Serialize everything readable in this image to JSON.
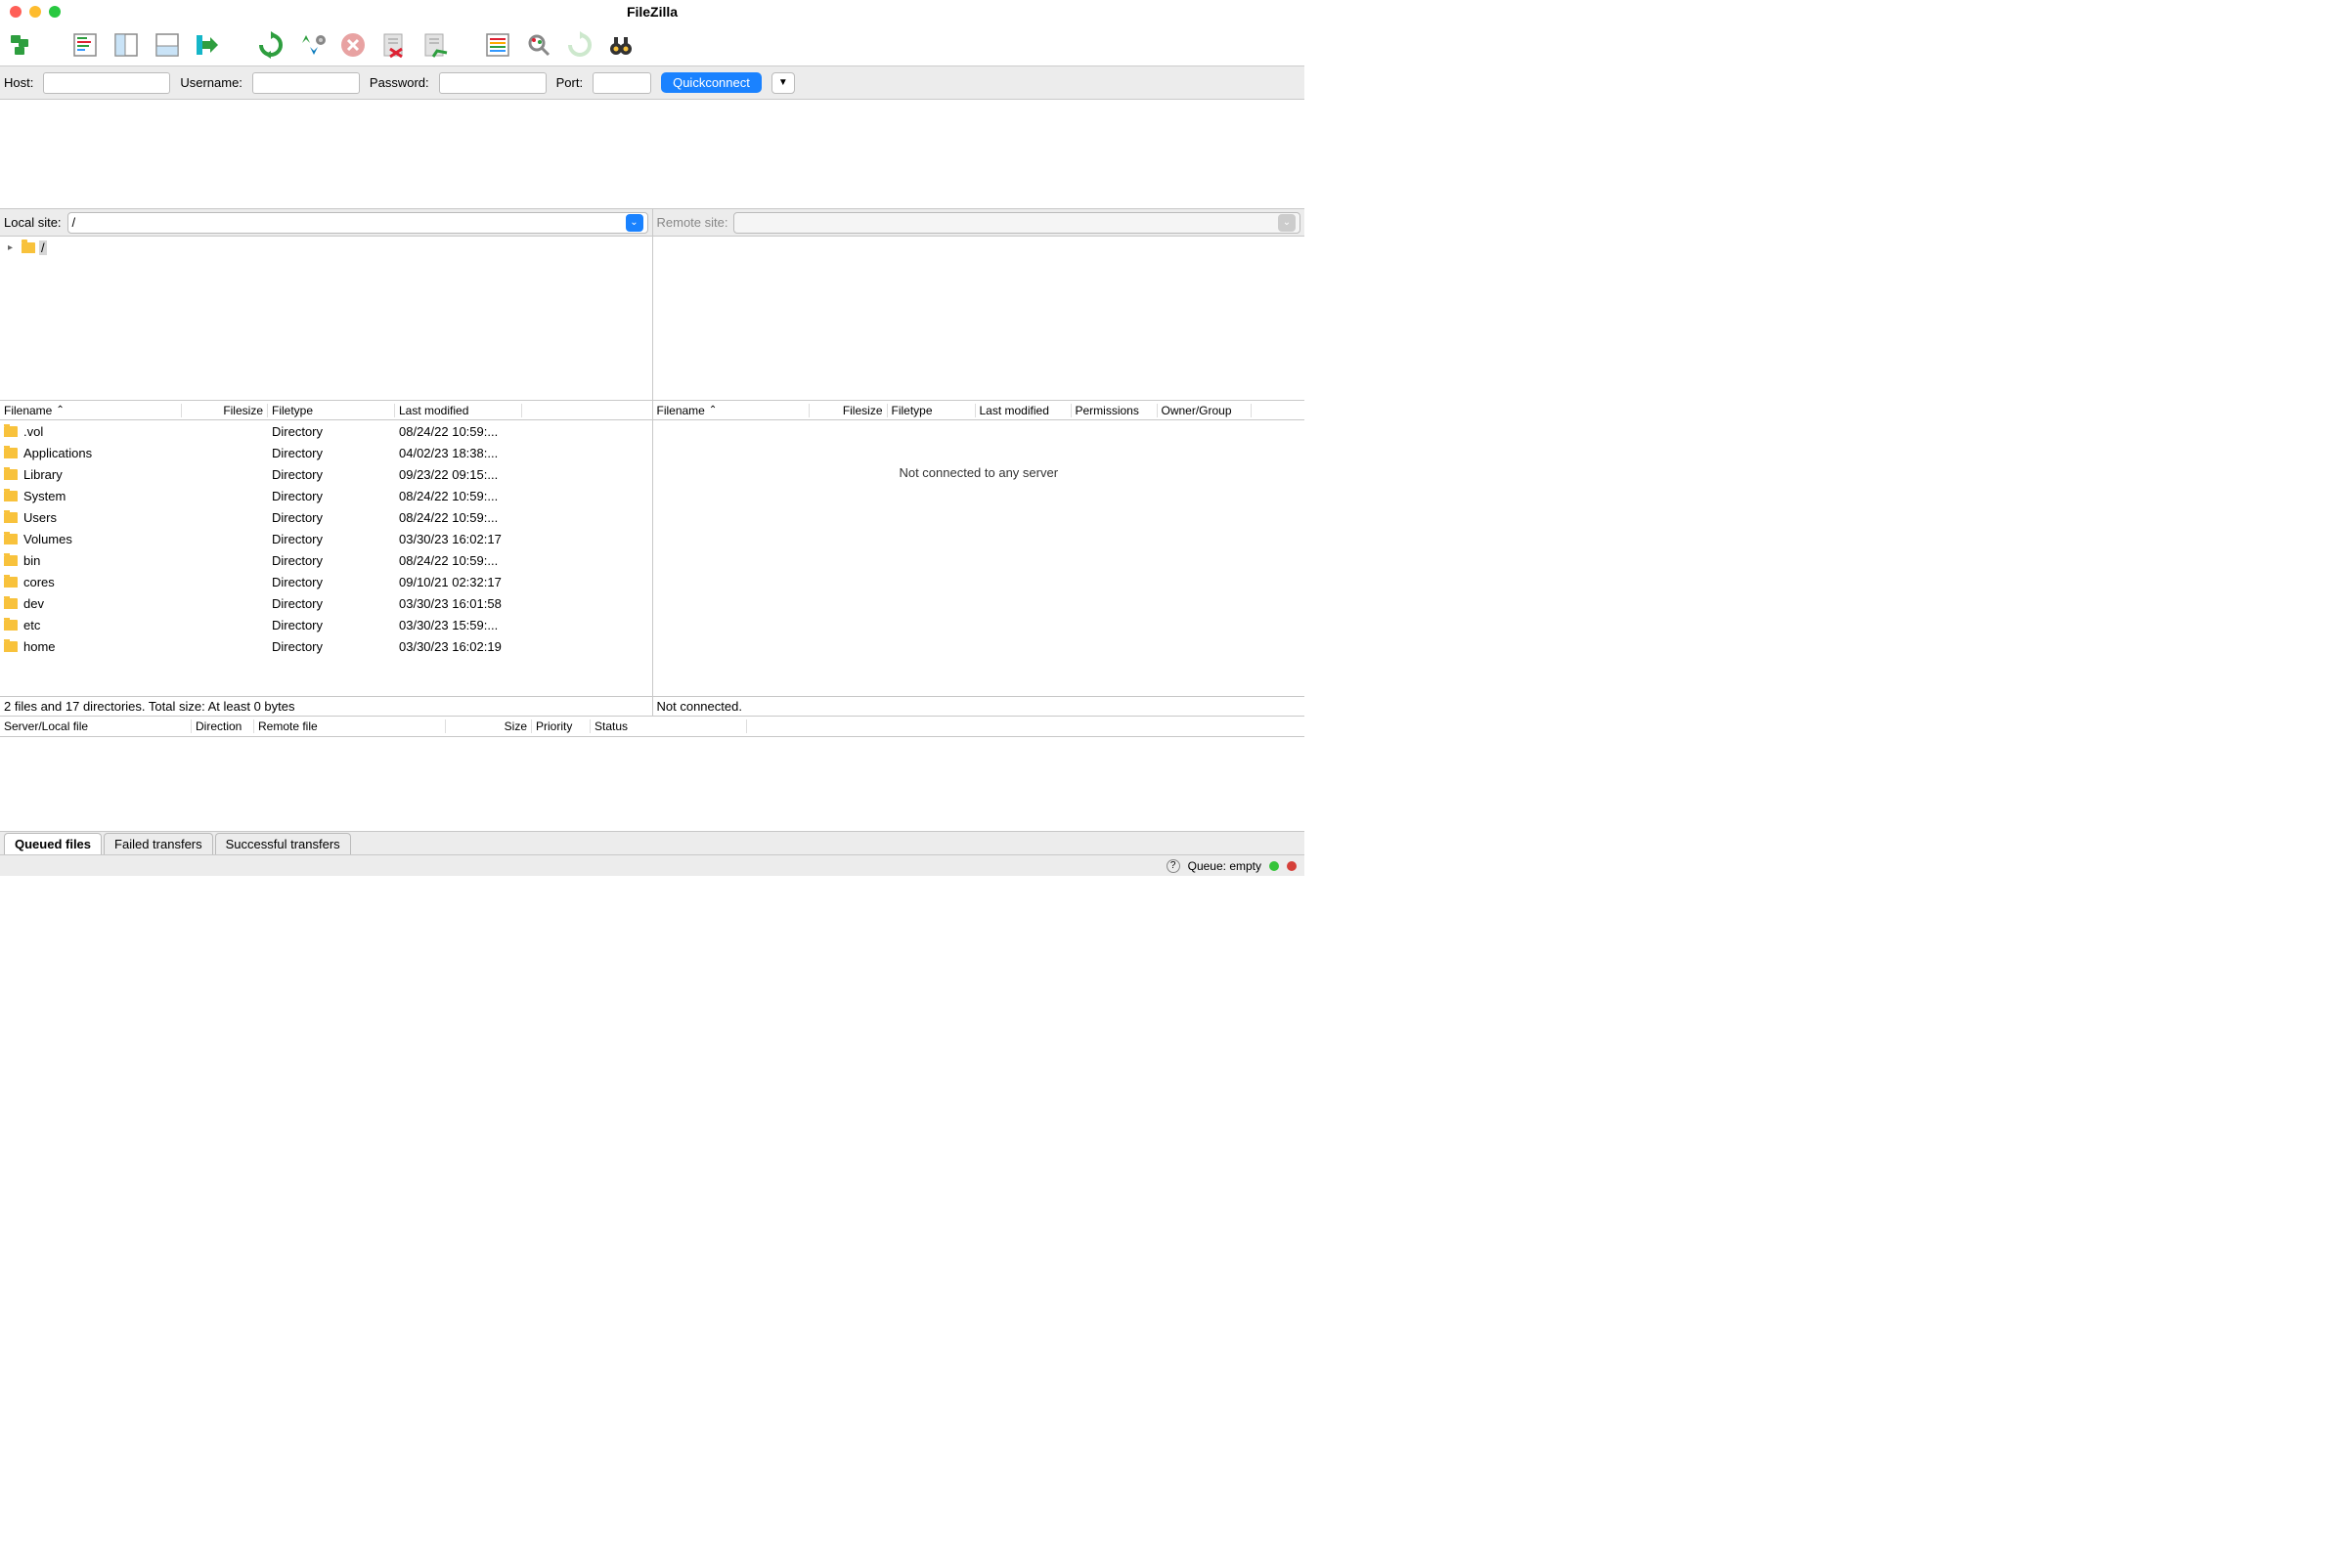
{
  "window": {
    "title": "FileZilla"
  },
  "quickconnect": {
    "host_label": "Host:",
    "username_label": "Username:",
    "password_label": "Password:",
    "port_label": "Port:",
    "button": "Quickconnect"
  },
  "local": {
    "label": "Local site:",
    "path": "/",
    "tree_root": "/",
    "columns": {
      "filename": "Filename",
      "filesize": "Filesize",
      "filetype": "Filetype",
      "lastmod": "Last modified"
    },
    "files": [
      {
        "name": ".vol",
        "size": "",
        "type": "Directory",
        "mod": "08/24/22 10:59:..."
      },
      {
        "name": "Applications",
        "size": "",
        "type": "Directory",
        "mod": "04/02/23 18:38:..."
      },
      {
        "name": "Library",
        "size": "",
        "type": "Directory",
        "mod": "09/23/22 09:15:..."
      },
      {
        "name": "System",
        "size": "",
        "type": "Directory",
        "mod": "08/24/22 10:59:..."
      },
      {
        "name": "Users",
        "size": "",
        "type": "Directory",
        "mod": "08/24/22 10:59:..."
      },
      {
        "name": "Volumes",
        "size": "",
        "type": "Directory",
        "mod": "03/30/23 16:02:17"
      },
      {
        "name": "bin",
        "size": "",
        "type": "Directory",
        "mod": "08/24/22 10:59:..."
      },
      {
        "name": "cores",
        "size": "",
        "type": "Directory",
        "mod": "09/10/21 02:32:17"
      },
      {
        "name": "dev",
        "size": "",
        "type": "Directory",
        "mod": "03/30/23 16:01:58"
      },
      {
        "name": "etc",
        "size": "",
        "type": "Directory",
        "mod": "03/30/23 15:59:..."
      },
      {
        "name": "home",
        "size": "",
        "type": "Directory",
        "mod": "03/30/23 16:02:19"
      }
    ],
    "status": "2 files and 17 directories. Total size: At least 0 bytes"
  },
  "remote": {
    "label": "Remote site:",
    "columns": {
      "filename": "Filename",
      "filesize": "Filesize",
      "filetype": "Filetype",
      "lastmod": "Last modified",
      "permissions": "Permissions",
      "owner": "Owner/Group"
    },
    "empty_message": "Not connected to any server",
    "status": "Not connected."
  },
  "queue": {
    "columns": {
      "server": "Server/Local file",
      "direction": "Direction",
      "remote": "Remote file",
      "size": "Size",
      "priority": "Priority",
      "status": "Status"
    },
    "tabs": {
      "queued": "Queued files",
      "failed": "Failed transfers",
      "successful": "Successful transfers"
    }
  },
  "bottom": {
    "queue_label": "Queue: empty"
  }
}
